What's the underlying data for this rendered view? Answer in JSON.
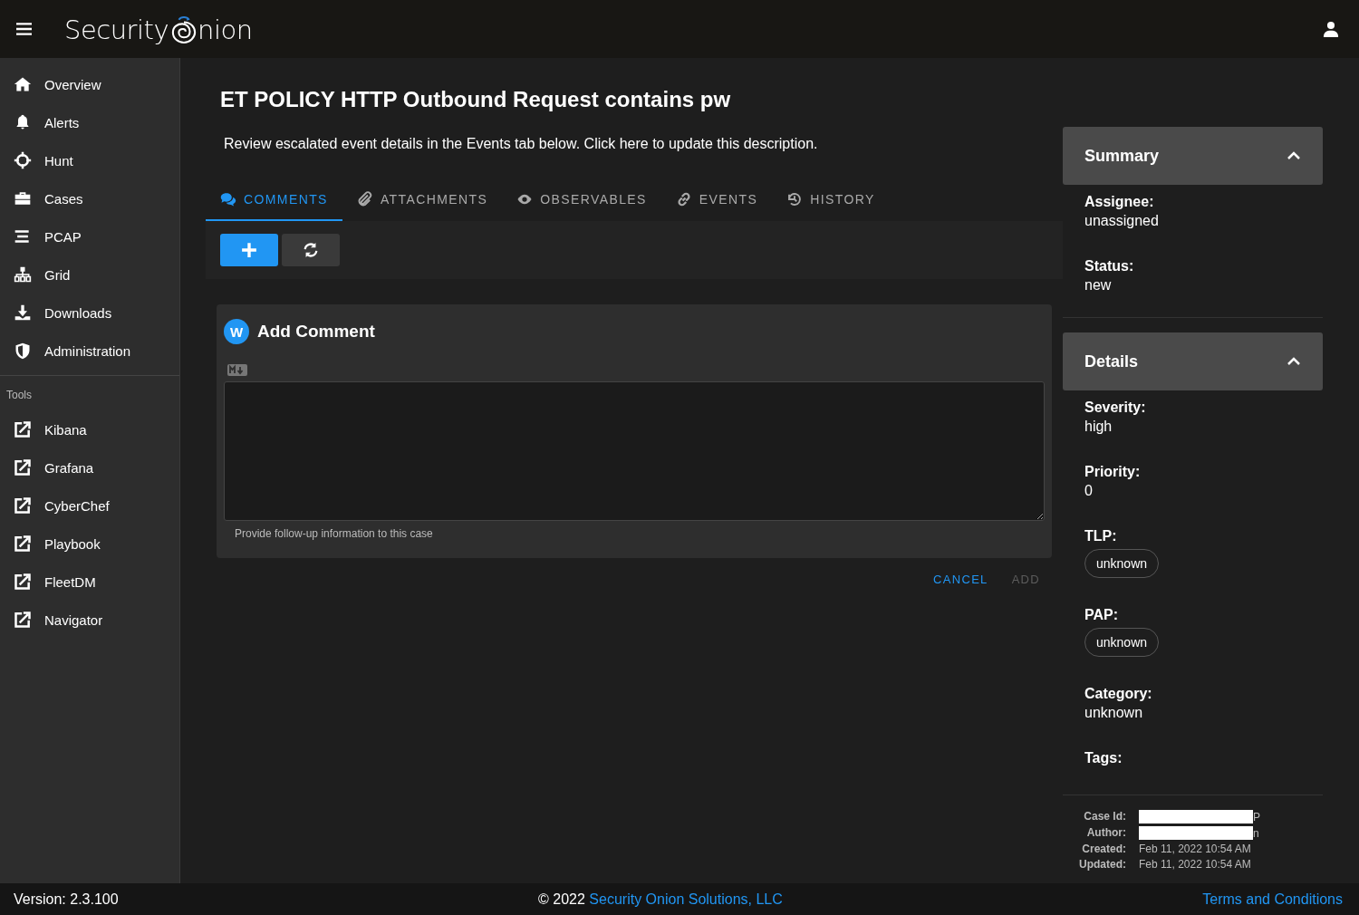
{
  "app_bar": {
    "logo_left": "Security",
    "logo_right": "nion"
  },
  "sidebar": {
    "items": [
      {
        "label": "Overview"
      },
      {
        "label": "Alerts"
      },
      {
        "label": "Hunt"
      },
      {
        "label": "Cases"
      },
      {
        "label": "PCAP"
      },
      {
        "label": "Grid"
      },
      {
        "label": "Downloads"
      },
      {
        "label": "Administration"
      }
    ],
    "tools_heading": "Tools",
    "tools": [
      {
        "label": "Kibana"
      },
      {
        "label": "Grafana"
      },
      {
        "label": "CyberChef"
      },
      {
        "label": "Playbook"
      },
      {
        "label": "FleetDM"
      },
      {
        "label": "Navigator"
      }
    ]
  },
  "case": {
    "title": "ET POLICY HTTP Outbound Request contains pw",
    "description": "Review escalated event details in the Events tab below. Click here to update this description.",
    "tabs": [
      {
        "label": "COMMENTS",
        "selected": true
      },
      {
        "label": "ATTACHMENTS",
        "selected": false
      },
      {
        "label": "OBSERVABLES",
        "selected": false
      },
      {
        "label": "EVENTS",
        "selected": false
      },
      {
        "label": "HISTORY",
        "selected": false
      }
    ],
    "comment_form": {
      "avatar": "W",
      "heading": "Add Comment",
      "hint": "Provide follow-up information to this case",
      "cancel": "CANCEL",
      "add": "ADD",
      "add_disabled": true
    }
  },
  "summary": {
    "title": "Summary",
    "expanded": true,
    "fields": [
      {
        "label": "Assignee:",
        "value": "unassigned",
        "kind": "text"
      },
      {
        "label": "Status:",
        "value": "new",
        "kind": "text"
      }
    ]
  },
  "details": {
    "title": "Details",
    "expanded": true,
    "fields": [
      {
        "label": "Severity:",
        "value": "high",
        "kind": "text"
      },
      {
        "label": "Priority:",
        "value": "0",
        "kind": "text"
      },
      {
        "label": "TLP:",
        "value": "unknown",
        "kind": "chip"
      },
      {
        "label": "PAP:",
        "value": "unknown",
        "kind": "chip"
      },
      {
        "label": "Category:",
        "value": "unknown",
        "kind": "text"
      },
      {
        "label": "Tags:",
        "kind": "empty"
      }
    ]
  },
  "meta": [
    {
      "label": "Case Id:",
      "value": "P",
      "redacted": true
    },
    {
      "label": "Author:",
      "value": "n",
      "redacted": true
    },
    {
      "label": "Created:",
      "value": "Feb 11, 2022 10:54 AM",
      "redacted": false
    },
    {
      "label": "Updated:",
      "value": "Feb 11, 2022 10:54 AM",
      "redacted": false
    }
  ],
  "footer": {
    "version": "Version: 2.3.100",
    "copyright": "© 2022",
    "company": "Security Onion Solutions, LLC",
    "terms": "Terms and Conditions"
  }
}
